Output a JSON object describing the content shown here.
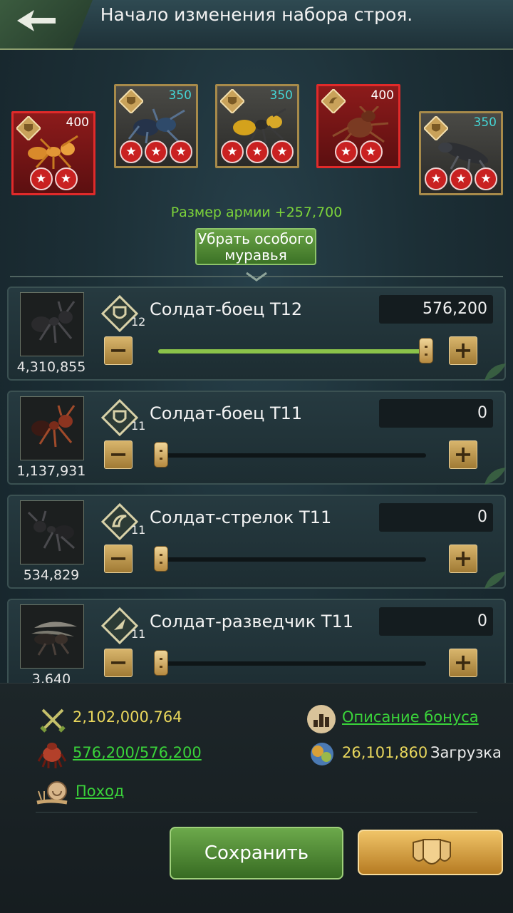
{
  "header": {
    "title": "Начало изменения набора строя."
  },
  "special_ants": [
    {
      "count": "400",
      "stars": 2,
      "frame": "red"
    },
    {
      "count": "350",
      "stars": 3,
      "frame": "gold"
    },
    {
      "count": "350",
      "stars": 3,
      "frame": "gold"
    },
    {
      "count": "400",
      "stars": 2,
      "frame": "red"
    },
    {
      "count": "350",
      "stars": 3,
      "frame": "gold"
    }
  ],
  "army": {
    "size_text": "Размер армии +257,700"
  },
  "remove_button": {
    "label": "Убрать особого муравья"
  },
  "troops": [
    {
      "stock": "4,310,855",
      "tier": "12",
      "name": "Солдат-боец T12",
      "qty": "576,200",
      "fill_fraction": 1.0,
      "type": "infantry"
    },
    {
      "stock": "1,137,931",
      "tier": "11",
      "name": "Солдат-боец T11",
      "qty": "0",
      "fill_fraction": 0.0,
      "type": "infantry"
    },
    {
      "stock": "534,829",
      "tier": "11",
      "name": "Солдат-стрелок T11",
      "qty": "0",
      "fill_fraction": 0.0,
      "type": "shooter"
    },
    {
      "stock": "3,640",
      "tier": "11",
      "name": "Солдат-разведчик T11",
      "qty": "0",
      "fill_fraction": 0.0,
      "type": "scout"
    }
  ],
  "bottom": {
    "power": "2,102,000,764",
    "bonus_link": "Описание бонуса",
    "troop_count": "576,200/576,200",
    "load_value": "26,101,860",
    "load_label": "Загрузка",
    "march_link": "Поход",
    "save_label": "Сохранить"
  },
  "colors": {
    "army_green": "#7cd33a",
    "link_green": "#3ad33a",
    "stat_yellow": "#e8d65c",
    "teal_count": "#44d6d6"
  }
}
